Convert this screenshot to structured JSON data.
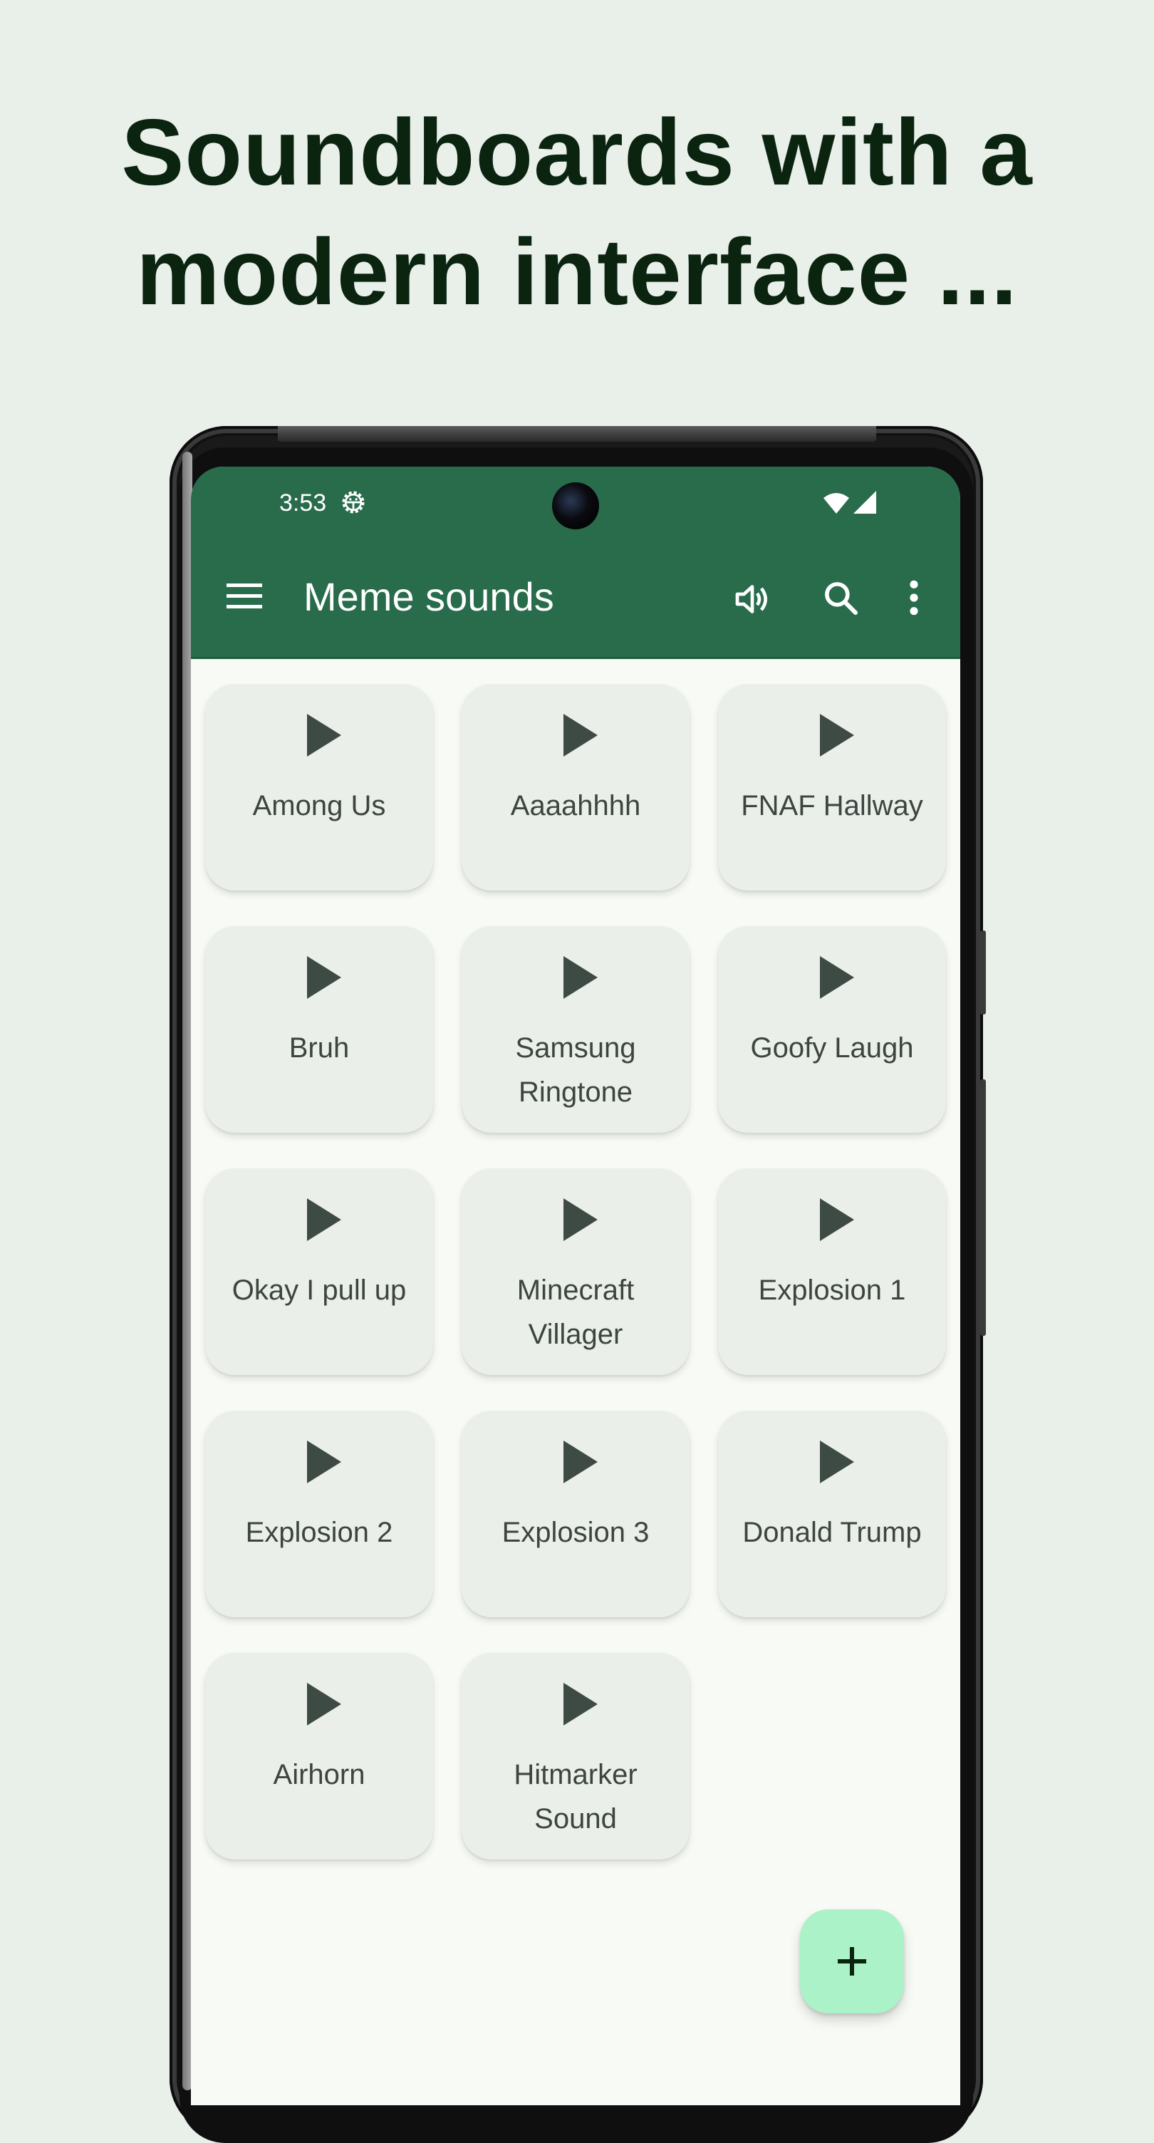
{
  "headline": {
    "line1": "Soundboards with a",
    "line2": "modern interface ..."
  },
  "status_bar": {
    "time": "3:53",
    "icons": [
      "debug-gear-icon",
      "wifi-icon",
      "cell-signal-icon"
    ]
  },
  "app_bar": {
    "title": "Meme sounds",
    "nav_icon": "menu-icon",
    "actions": [
      "volume-icon",
      "search-icon",
      "more-vert-icon"
    ],
    "color": "#286C4C"
  },
  "sounds": [
    {
      "label": "Among Us"
    },
    {
      "label": "Aaaahhhh"
    },
    {
      "label": "FNAF Hallway"
    },
    {
      "label": "Bruh"
    },
    {
      "label": "Samsung Ringtone"
    },
    {
      "label": "Goofy Laugh"
    },
    {
      "label": "Okay I pull up"
    },
    {
      "label": "Minecraft Villager"
    },
    {
      "label": "Explosion 1"
    },
    {
      "label": "Explosion 2"
    },
    {
      "label": "Explosion 3"
    },
    {
      "label": "Donald Trump"
    },
    {
      "label": "Airhorn"
    },
    {
      "label": "Hitmarker Sound"
    }
  ],
  "fab": {
    "icon": "plus-icon",
    "color": "#ACF2C8"
  },
  "colors": {
    "background": "#E9EFE9",
    "headline": "#0B2410",
    "card": "#EBEFEA",
    "card_text": "#3C4540",
    "content_bg": "#F8FAF5"
  }
}
